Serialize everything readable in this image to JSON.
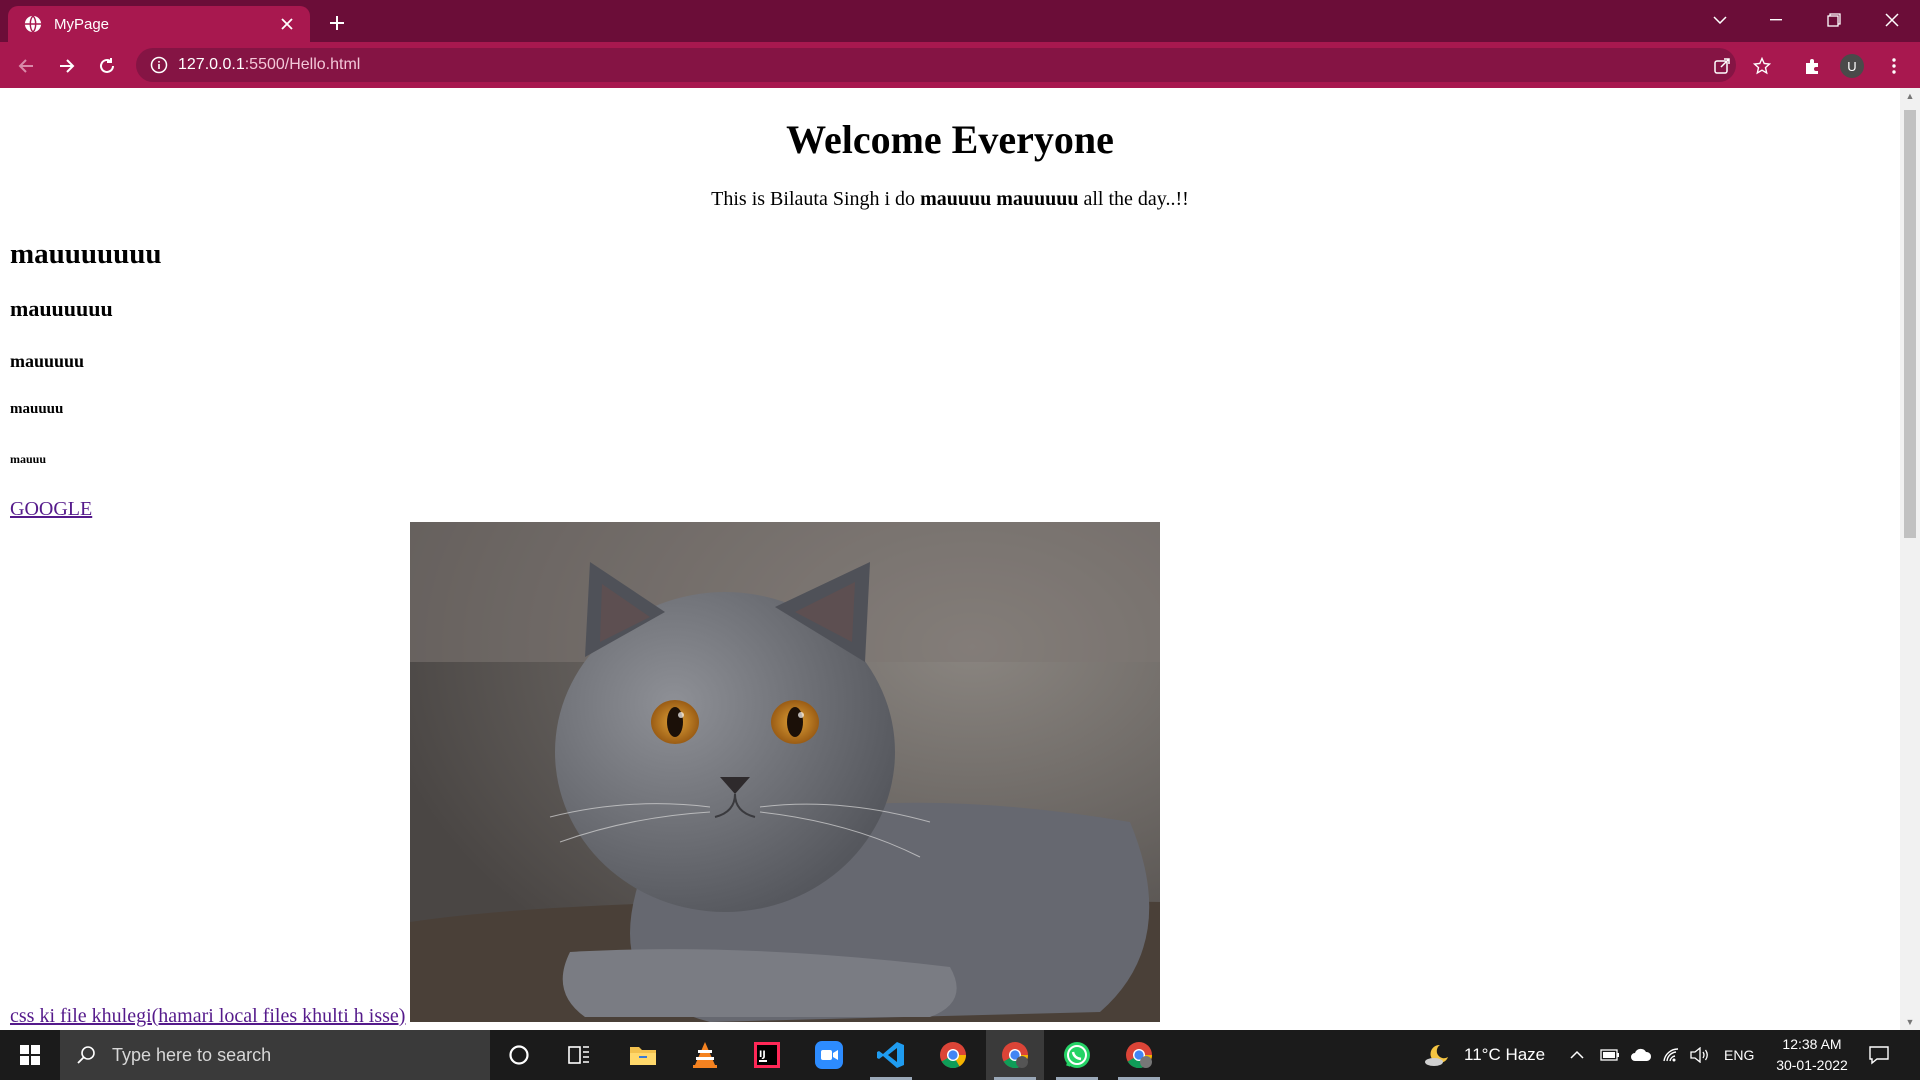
{
  "browser": {
    "tab_title": "MyPage",
    "url_host": "127.0.0.1",
    "url_path": ":5500/Hello.html",
    "profile_initial": "U",
    "theme_color": "#a8184f"
  },
  "page": {
    "title": "Welcome Everyone",
    "intro_prefix": "This is Bilauta Singh i do ",
    "intro_bold": "mauuuu mauuuuu",
    "intro_suffix": " all the day..!!",
    "h2": "mauuuuuuu",
    "h3": "mauuuuuu",
    "h4": "mauuuuu",
    "h5": "mauuuu",
    "h6": "mauuu",
    "google_link": "GOOGLE",
    "image_alt": "grey cat",
    "css_link": "css ki file khulegi(hamari local files khulti h isse)"
  },
  "taskbar": {
    "search_placeholder": "Type here to search",
    "weather": "11°C  Haze",
    "language": "ENG",
    "time": "12:38 AM",
    "date": "30-01-2022",
    "apps": [
      "cortana-icon",
      "task-view-icon",
      "file-explorer-icon",
      "vlc-icon",
      "intellij-icon",
      "zoom-icon",
      "vscode-icon",
      "chrome-icon",
      "chrome-profile-icon",
      "whatsapp-icon",
      "chrome-profile-2-icon"
    ]
  }
}
